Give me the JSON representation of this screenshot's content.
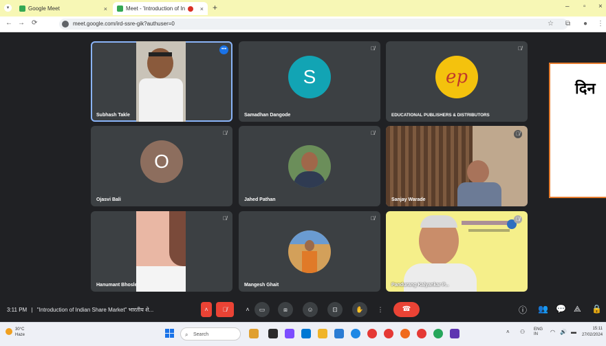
{
  "browser": {
    "tabs": [
      {
        "title": "Google Meet",
        "active": false
      },
      {
        "title": "Meet - 'Introduction of Ind'",
        "active": true
      }
    ],
    "url": "meet.google.com/ird-ssre-gik?authuser=0"
  },
  "participants": [
    {
      "name": "Subhash Takle",
      "kind": "video",
      "highlight": true
    },
    {
      "name": "Samadhan Dangode",
      "kind": "initial",
      "initial": "S",
      "color": "#12a4b4"
    },
    {
      "name": "EDUCATIONAL PUBLISHERS & DISTRIBUTORS",
      "kind": "logo",
      "logo_text": "ep"
    },
    {
      "name": "Ojasvi Bali",
      "kind": "initial",
      "initial": "O",
      "color": "#8d6e5e"
    },
    {
      "name": "Jahed Pathan",
      "kind": "photo"
    },
    {
      "name": "Sanjay Warade",
      "kind": "video"
    },
    {
      "name": "Hanumant Bhosle",
      "kind": "video"
    },
    {
      "name": "Mangesh Ghait",
      "kind": "photo"
    },
    {
      "name": "Pandurang Kalyankar P...",
      "kind": "video"
    }
  ],
  "presentation": {
    "text": "दिन"
  },
  "controls": {
    "time": "3:11 PM",
    "separator": "|",
    "meeting_title": "\"Introduction of Indian Share Market\" भारतीय शे..."
  },
  "taskbar": {
    "weather_temp": "30°C",
    "weather_desc": "Haze",
    "search_placeholder": "Search",
    "lang": "ENG",
    "lang_sub": "IN",
    "clock_time": "15:11",
    "clock_date": "27/02/2024"
  }
}
